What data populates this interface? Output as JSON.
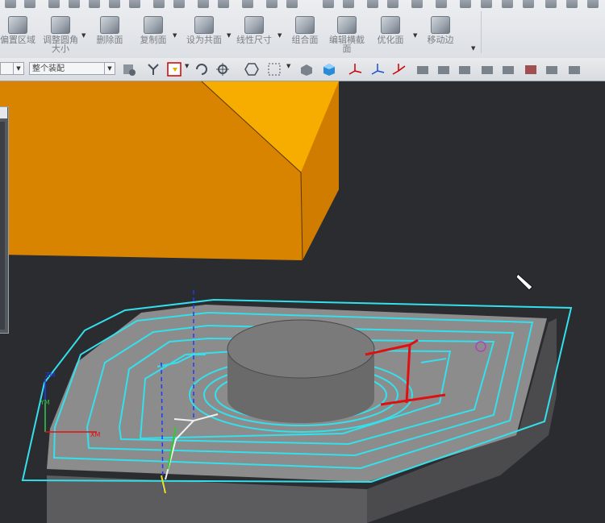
{
  "ribbon": {
    "buttons": [
      {
        "label": "偏置区域",
        "label2": ""
      },
      {
        "label": "调整圆角",
        "label2": "大小"
      },
      {
        "label": "删除面",
        "label2": ""
      },
      {
        "label": "复制面",
        "label2": ""
      },
      {
        "label": "设为共面",
        "label2": ""
      },
      {
        "label": "线性尺寸",
        "label2": ""
      },
      {
        "label": "组合面",
        "label2": ""
      },
      {
        "label": "编辑横截",
        "label2": "面"
      },
      {
        "label": "优化面",
        "label2": ""
      },
      {
        "label": "移动边",
        "label2": ""
      }
    ]
  },
  "toolbar": {
    "filter_value": "",
    "selection_scope": "整个装配"
  },
  "viewport": {
    "colors": {
      "background": "#2a2c30",
      "block": "#d88400",
      "part_top": "#8c8c8c",
      "toolpath": "#33e0ec",
      "annotation": "#e01010"
    },
    "axis_labels": {
      "zm": "ZM",
      "ym": "YM",
      "xm": "XM"
    }
  }
}
